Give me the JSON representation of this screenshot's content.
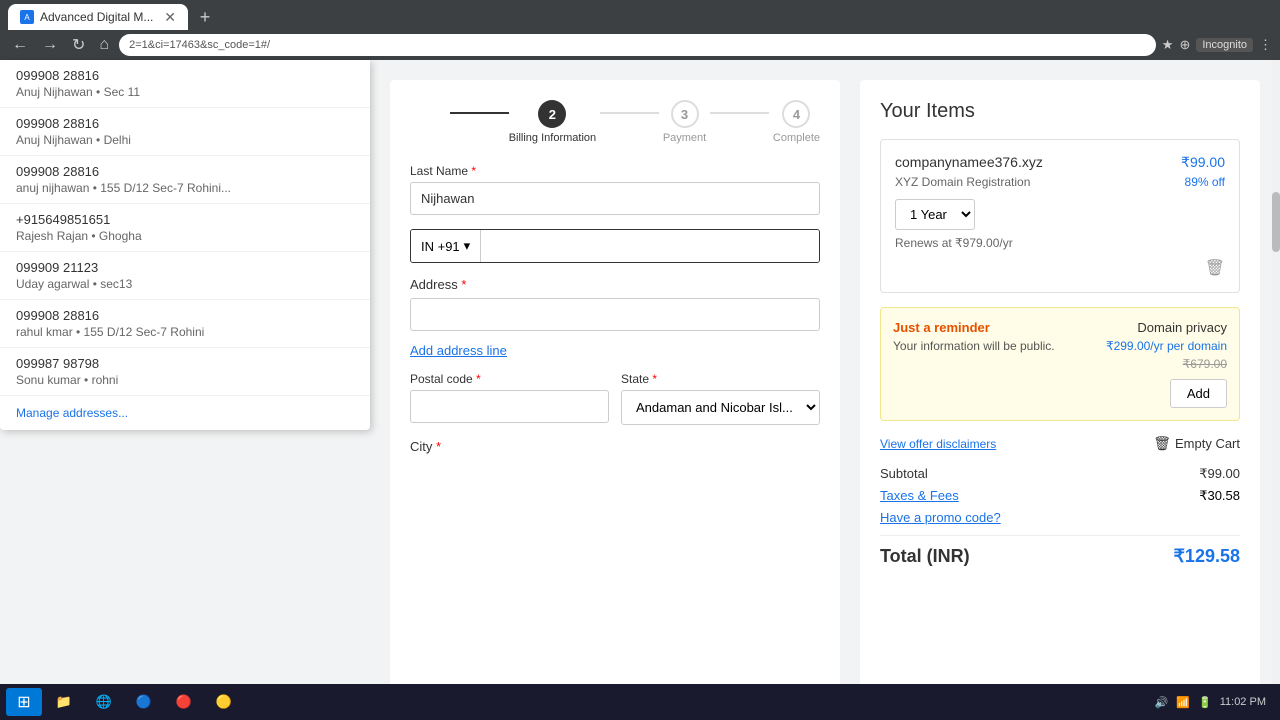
{
  "browser": {
    "tab_title": "Advanced Digital M...",
    "tab_icon": "A",
    "url": "2=1&ci=17463&sc_code=1#/",
    "nav": {
      "back": "←",
      "forward": "→",
      "refresh": "↻",
      "home": "⌂"
    },
    "browser_icons": [
      "★",
      "⊕",
      "♥"
    ],
    "incognito_label": "Incognito",
    "user_name": "Incognito"
  },
  "autocomplete": {
    "items": [
      {
        "phone": "099908 28816",
        "details": "Anuj Nijhawan • Sec 11"
      },
      {
        "phone": "099908 28816",
        "details": "Anuj Nijhawan • Delhi"
      },
      {
        "phone": "099908 28816",
        "details": "anuj nijhawan • 155 D/12 Sec-7 Rohini..."
      },
      {
        "phone": "+915649851651",
        "details": "Rajesh Rajan • Ghogha"
      },
      {
        "phone": "099909 21123",
        "details": "Uday agarwal • sec13"
      },
      {
        "phone": "099908 28816",
        "details": "rahul kmar • 155 D/12 Sec-7 Rohini"
      },
      {
        "phone": "099987 98798",
        "details": "Sonu kumar • rohni"
      }
    ],
    "manage_label": "Manage addresses..."
  },
  "progress": {
    "steps": [
      {
        "number": "2",
        "label": "Billing Information",
        "active": true
      },
      {
        "number": "3",
        "label": "Payment",
        "active": false
      },
      {
        "number": "4",
        "label": "Complete",
        "active": false
      }
    ]
  },
  "form": {
    "last_name_label": "Last Name",
    "last_name_required": "*",
    "last_name_value": "Nijhawan",
    "phone_prefix": "IN +91",
    "phone_placeholder": "",
    "address_label": "Address",
    "address_required": "*",
    "address_value": "",
    "add_address_line": "Add address line",
    "postal_label": "Postal code",
    "postal_required": "*",
    "postal_value": "",
    "state_label": "State",
    "state_required": "*",
    "state_value": "Andaman and Nicobar Isl...",
    "city_label": "City",
    "city_required": "*"
  },
  "order": {
    "title": "Your Items",
    "domain": {
      "name": "companynamee376.xyz",
      "type": "XYZ Domain Registration",
      "price": "₹99.00",
      "discount": "89% off",
      "year": "1 Year",
      "renews": "Renews at ₹979.00/yr"
    },
    "reminder": {
      "title": "Just a reminder",
      "text": "Your information will be public.",
      "info_icon": "ℹ"
    },
    "privacy": {
      "label": "Domain privacy",
      "price": "₹299.00/yr per domain",
      "original": "₹679.00",
      "add_label": "Add"
    },
    "view_offer": "View offer disclaimers",
    "empty_cart": "Empty Cart",
    "subtotal_label": "Subtotal",
    "subtotal_value": "₹99.00",
    "taxes_label": "Taxes & Fees",
    "taxes_value": "₹30.58",
    "promo_label": "Have a promo code?",
    "total_label": "Total (INR)",
    "total_value": "₹129.58"
  },
  "taskbar": {
    "time": "11:02 PM",
    "items": [
      "⊞",
      "📁",
      "🌐",
      "🔵",
      "🔴",
      "🟡"
    ],
    "system_icons": [
      "🔊",
      "📶",
      "🔋"
    ]
  }
}
